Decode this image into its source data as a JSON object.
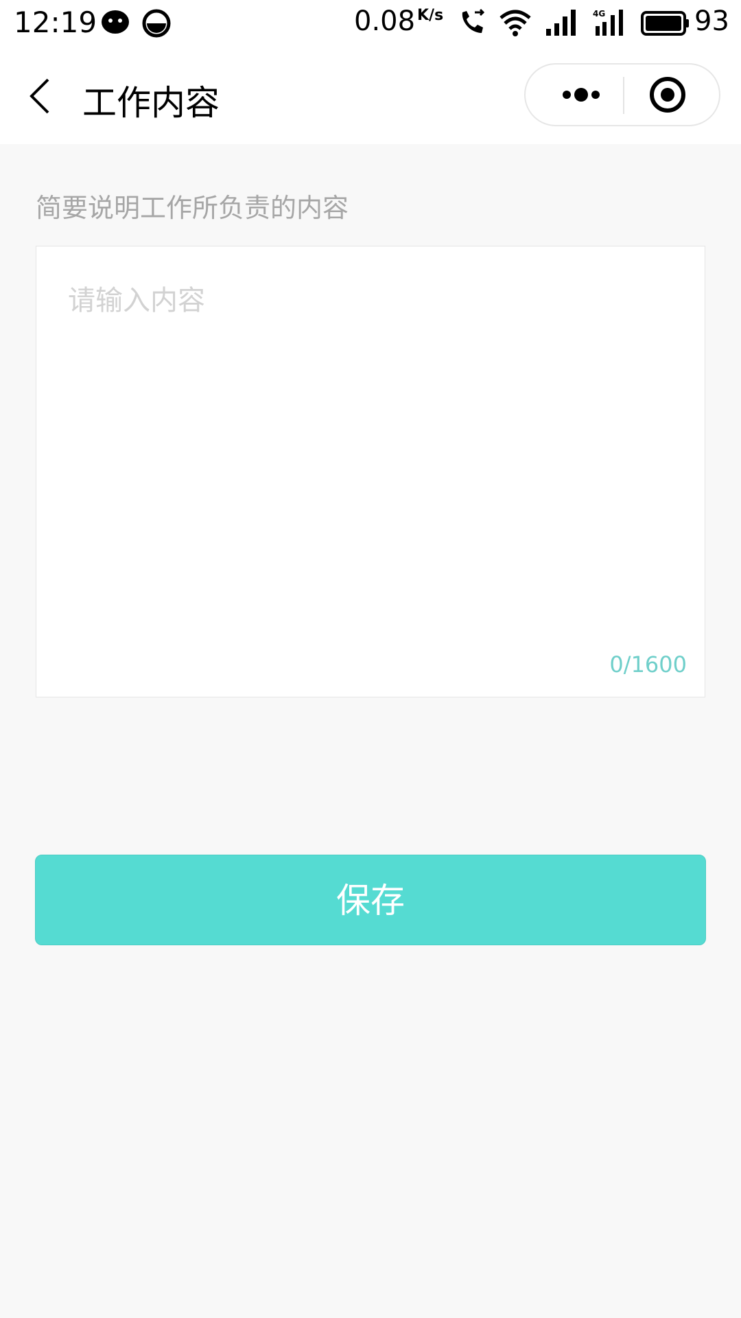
{
  "status_bar": {
    "time": "12:19",
    "net_speed": "0.08",
    "net_unit": "K/s",
    "battery": "93",
    "icons": [
      "wechat-icon",
      "app-icon",
      "call-icon",
      "wifi-icon",
      "signal-icon",
      "signal-4g-icon",
      "battery-icon"
    ]
  },
  "nav": {
    "title": "工作内容"
  },
  "form": {
    "hint": "简要说明工作所负责的内容",
    "placeholder": "请输入内容",
    "value": "",
    "counter": "0/1600"
  },
  "actions": {
    "save_label": "保存"
  },
  "colors": {
    "accent": "#55dbd2",
    "counter": "#6fcfca",
    "background": "#f8f8f8"
  }
}
